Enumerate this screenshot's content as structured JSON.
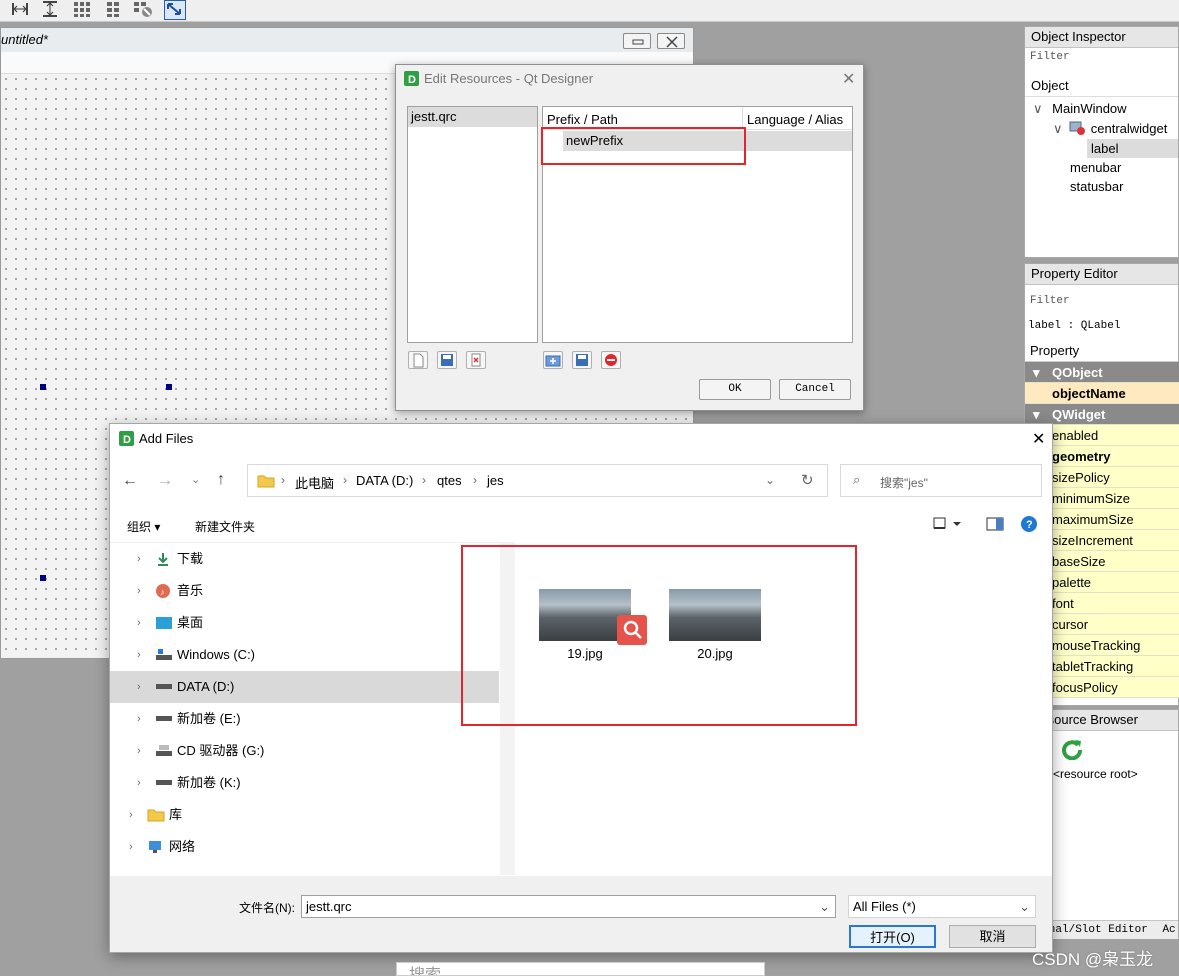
{
  "form": {
    "title": "untitled*"
  },
  "object_inspector": {
    "title": "Object Inspector",
    "filter": "Filter",
    "header": "Object",
    "tree": [
      "MainWindow",
      "centralwidget",
      "label",
      "menubar",
      "statusbar"
    ]
  },
  "property_editor": {
    "title": "Property Editor",
    "filter": "Filter",
    "context": "label : QLabel",
    "header": "Property",
    "rows": [
      "QObject",
      "objectName",
      "QWidget",
      "enabled",
      "geometry",
      "sizePolicy",
      "minimumSize",
      "maximumSize",
      "sizeIncrement",
      "baseSize",
      "palette",
      "font",
      "cursor",
      "mouseTracking",
      "tabletTracking",
      "focusPolicy"
    ]
  },
  "resource_browser": {
    "title": "Resource Browser",
    "root": "<resource root>"
  },
  "bottom_tabs": {
    "signal_slot": "Signal/Slot Editor",
    "action": "Ac"
  },
  "edit_resources": {
    "title": "Edit Resources - Qt Designer",
    "files": [
      "jestt.qrc"
    ],
    "col_prefix": "Prefix / Path",
    "col_lang": "Language / Alias",
    "prefix": "newPrefix",
    "ok": "OK",
    "cancel": "Cancel"
  },
  "add_files": {
    "title": "Add Files",
    "breadcrumb": [
      "此电脑",
      "DATA (D:)",
      "qtes",
      "jes"
    ],
    "search_placeholder": "搜索\"jes\"",
    "organize": "组织 ▾",
    "new_folder": "新建文件夹",
    "nav": [
      "下载",
      "音乐",
      "桌面",
      "Windows (C:)",
      "DATA (D:)",
      "新加卷 (E:)",
      "CD 驱动器 (G:)",
      "新加卷 (K:)",
      "库",
      "网络"
    ],
    "files": [
      "19.jpg",
      "20.jpg"
    ],
    "filename_label": "文件名(N):",
    "filename_value": "jestt.qrc",
    "filter_value": "All Files (*)",
    "open": "打开(O)",
    "cancel": "取消"
  },
  "taskbar_search": "搜索",
  "watermark": "CSDN @枭玉龙",
  "colors": {
    "highlight_red": "#e4252b",
    "qt_green": "#2ea043",
    "group_gray": "#8a8a8a",
    "prop_yellow": "#ffffc8"
  }
}
